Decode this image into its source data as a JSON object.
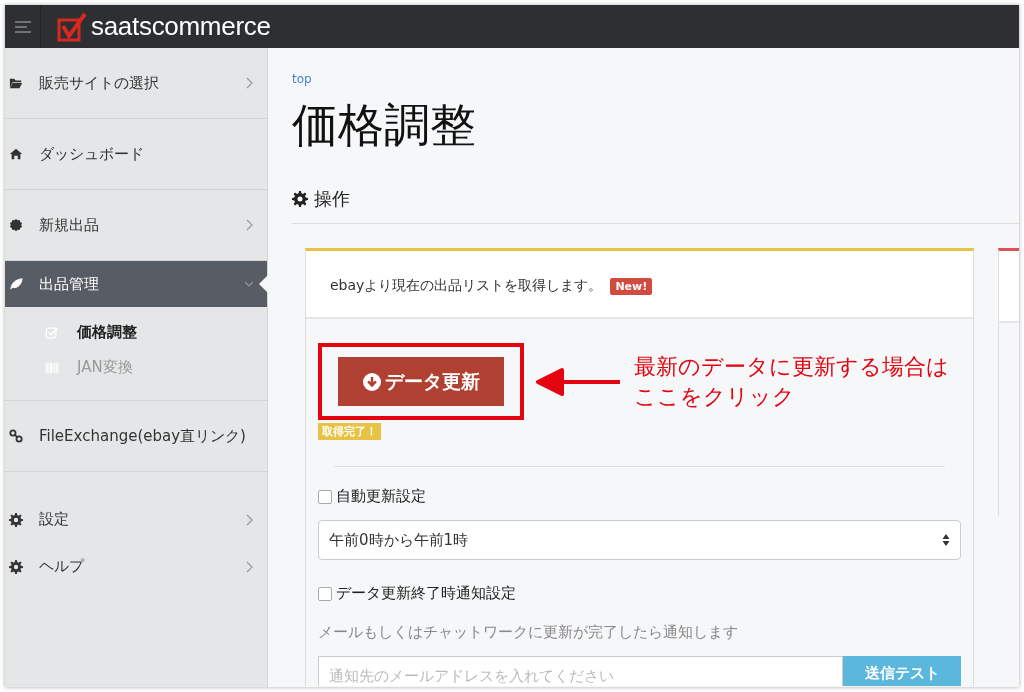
{
  "header": {
    "logo": "saatscommerce"
  },
  "sidebar": {
    "items": [
      {
        "label": "販売サイトの選択",
        "has_arrow": true,
        "expanded": false,
        "selected": false
      },
      {
        "label": "ダッシュボード",
        "has_arrow": false,
        "selected": false
      },
      {
        "label": "新規出品",
        "has_arrow": true,
        "expanded": false,
        "selected": false
      },
      {
        "label": "出品管理",
        "has_arrow": true,
        "expanded": true,
        "selected": true,
        "children": [
          {
            "label": "価格調整",
            "selected": true
          },
          {
            "label": "JAN変換",
            "selected": false
          }
        ]
      },
      {
        "label": "FileExchange(ebay直リンク)",
        "has_arrow": false,
        "selected": false
      },
      {
        "label": "設定",
        "has_arrow": true,
        "expanded": false,
        "selected": false
      },
      {
        "label": "ヘルプ",
        "has_arrow": true,
        "expanded": false,
        "selected": false
      }
    ]
  },
  "breadcrumb": "top",
  "page_title": "価格調整",
  "section_title": "操作",
  "card": {
    "description": "ebayより現在の出品リストを取得します。",
    "new_badge": "New!",
    "update_button": "データ更新",
    "status_badge": "取得完了！",
    "auto_update": {
      "label": "自動更新設定",
      "checked": false
    },
    "time_select": {
      "value": "午前0時から午前1時"
    },
    "notify": {
      "label": "データ更新終了時通知設定",
      "checked": false
    },
    "notify_help": "メールもしくはチャットワークに更新が完了したら通知します",
    "email_field": {
      "placeholder": "通知先のメールアドレスを入れてください"
    },
    "send_test_button": "送信テスト"
  },
  "annotation": {
    "lines": [
      "最新のデータに更新する場合は",
      "ここをクリック"
    ]
  }
}
